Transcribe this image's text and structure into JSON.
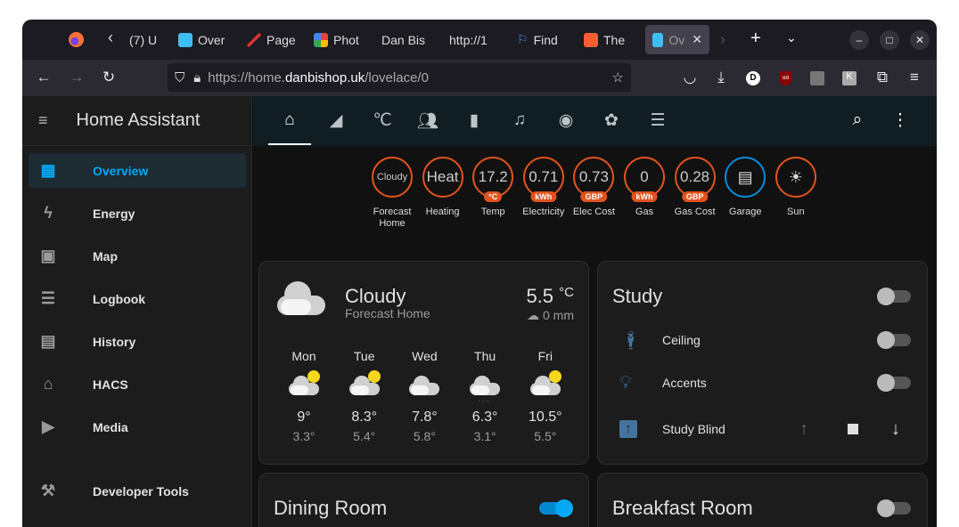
{
  "browser": {
    "tabs": [
      {
        "label": "(7) U"
      },
      {
        "label": "Over"
      },
      {
        "label": "Page"
      },
      {
        "label": "Phot"
      },
      {
        "label": "Dan Bis"
      },
      {
        "label": "http://1"
      },
      {
        "label": "Find"
      },
      {
        "label": "The"
      },
      {
        "label": "Ov",
        "active": true
      }
    ],
    "url": {
      "prefix": "https://home.",
      "domain": "danbishop.uk",
      "path": "/lovelace/0"
    }
  },
  "sidebar": {
    "title": "Home Assistant",
    "items": [
      {
        "label": "Overview",
        "icon": "view-dashboard-icon",
        "selected": true
      },
      {
        "label": "Energy",
        "icon": "lightning-icon"
      },
      {
        "label": "Map",
        "icon": "map-account-icon"
      },
      {
        "label": "Logbook",
        "icon": "list-icon"
      },
      {
        "label": "History",
        "icon": "chart-box-icon"
      },
      {
        "label": "HACS",
        "icon": "hacs-icon"
      },
      {
        "label": "Media",
        "icon": "play-box-icon"
      },
      {
        "label": "Developer Tools",
        "icon": "hammer-icon"
      }
    ]
  },
  "views": [
    "home-icon",
    "cctv-icon",
    "thermometer-celsius-icon",
    "account-group-icon",
    "battery-icon",
    "music-icon",
    "robot-vacuum-icon",
    "flower-icon",
    "server-icon"
  ],
  "badges": [
    {
      "value": "Cloudy",
      "label": "Forecast Home"
    },
    {
      "value": "Heat",
      "label": "Heating"
    },
    {
      "value": "17.2",
      "unit": "°C",
      "label": "Temp"
    },
    {
      "value": "0.71",
      "unit": "kWh",
      "label": "Electricity"
    },
    {
      "value": "0.73",
      "unit": "GBP",
      "label": "Elec Cost"
    },
    {
      "value": "0",
      "unit": "kWh",
      "label": "Gas"
    },
    {
      "value": "0.28",
      "unit": "GBP",
      "label": "Gas Cost"
    },
    {
      "value": "",
      "label": "Garage",
      "icon": "garage-icon"
    },
    {
      "value": "",
      "label": "Sun",
      "icon": "sun-icon"
    }
  ],
  "weather": {
    "condition": "Cloudy",
    "name": "Forecast Home",
    "temp": "5.5",
    "unit": "°C",
    "precip": "0 mm",
    "forecast": [
      {
        "day": "Mon",
        "high": "9°",
        "low": "3.3°",
        "icon": "partly-cloudy"
      },
      {
        "day": "Tue",
        "high": "8.3°",
        "low": "5.4°",
        "icon": "partly-cloudy"
      },
      {
        "day": "Wed",
        "high": "7.8°",
        "low": "5.8°",
        "icon": "cloudy"
      },
      {
        "day": "Thu",
        "high": "6.3°",
        "low": "3.1°",
        "icon": "rainy"
      },
      {
        "day": "Fri",
        "high": "10.5°",
        "low": "5.5°",
        "icon": "partly-cloudy"
      }
    ]
  },
  "study": {
    "title": "Study",
    "on": false,
    "rows": [
      {
        "label": "Ceiling",
        "icon": "human-handsup-icon",
        "on": false
      },
      {
        "label": "Accents",
        "icon": "lightbulb-icon",
        "on": false
      },
      {
        "label": "Study Blind",
        "icon": "blind-icon"
      }
    ]
  },
  "dining": {
    "title": "Dining Room",
    "on": true
  },
  "breakfast": {
    "title": "Breakfast Room",
    "on": false
  }
}
